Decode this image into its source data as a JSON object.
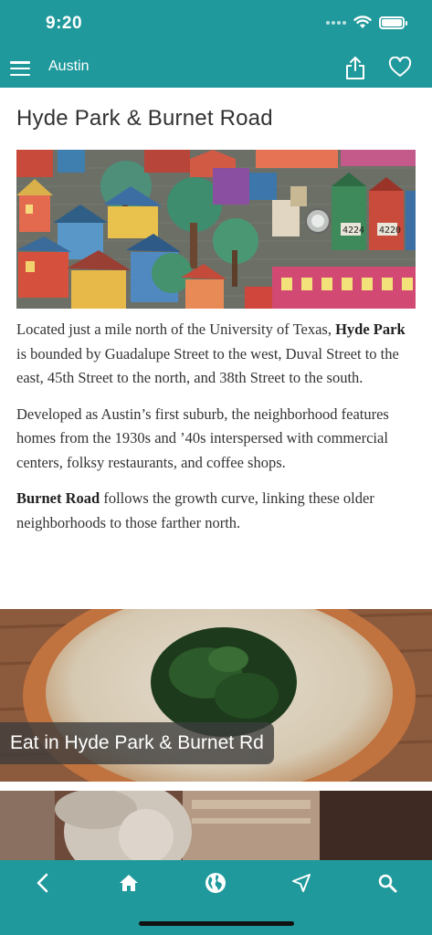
{
  "status": {
    "time": "9:20"
  },
  "header": {
    "title": "Austin",
    "icons": [
      "menu-icon",
      "share-icon",
      "heart-icon"
    ]
  },
  "page": {
    "title": "Hyde Park & Burnet Road",
    "paragraphs": [
      {
        "before": "Located just a mile north of the University of Texas, ",
        "bold": "Hyde Park",
        "after": " is bounded by Guadalupe Street to the west, Duval Street to the east, 45th Street to the north, and 38th Street to the south."
      },
      {
        "before": "Developed as Austin’s first suburb, the neighborhood features homes from the 1930s and ’40s interspersed with commercial centers, folksy restaurants, and coffee shops.",
        "bold": "",
        "after": ""
      },
      {
        "before": "",
        "bold": "Burnet Road",
        "after": " follows the growth curve, linking these older neighborhoods to those farther north."
      }
    ],
    "mural_numbers": [
      "4224",
      "4220"
    ]
  },
  "cards": [
    {
      "label": "Eat in Hyde Park & Burnet Rd"
    }
  ],
  "bottom_nav": {
    "icons": [
      "back-icon",
      "home-icon",
      "globe-icon",
      "location-arrow-icon",
      "search-icon"
    ]
  },
  "colors": {
    "teal": "#20999c"
  }
}
